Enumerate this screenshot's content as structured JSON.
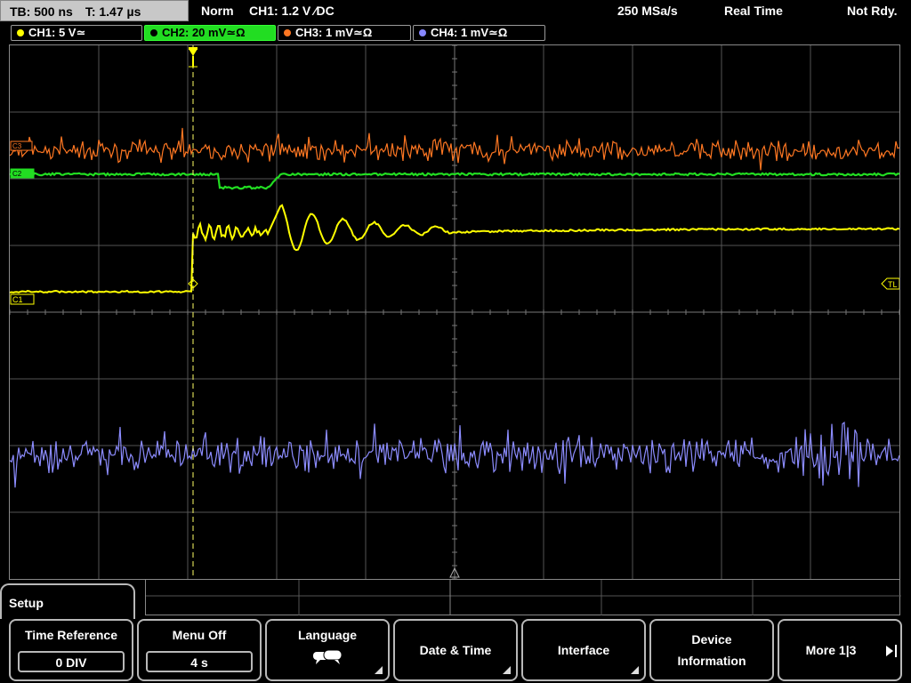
{
  "topbar": {
    "timebase": "TB: 500 ns",
    "trigger_time": "T: 1.47 µs",
    "mode": "Norm",
    "trigger": "CH1: 1.2 V ∕DC",
    "sample_rate": "250 MSa/s",
    "acq_mode": "Real Time",
    "status": "Not Rdy."
  },
  "channels": [
    {
      "label": "CH1: 5 V≃",
      "color": "#ffff00",
      "active": false
    },
    {
      "label": "CH2: 20 mV≃Ω",
      "color": "#22dd22",
      "active": true
    },
    {
      "label": "CH3: 1 mV≃Ω",
      "color": "#ff7722",
      "active": false
    },
    {
      "label": "CH4: 1 mV≃Ω",
      "color": "#8888ff",
      "active": false
    }
  ],
  "markers": {
    "trigger_level": "TL",
    "ch1": "C1",
    "ch2": "C2",
    "ch3": "C3"
  },
  "menu": {
    "title": "Setup",
    "softkeys": {
      "time_reference": {
        "label": "Time Reference",
        "value": "0 DIV"
      },
      "menu_off": {
        "label": "Menu Off",
        "value": "4 s"
      },
      "language": {
        "label": "Language"
      },
      "date_time": {
        "label": "Date & Time"
      },
      "interface": {
        "label": "Interface"
      },
      "device_info": {
        "line1": "Device",
        "line2": "Information"
      },
      "more": {
        "label": "More 1|3"
      }
    }
  },
  "colors": {
    "ch1": "#ffff00",
    "ch2": "#22dd22",
    "ch3": "#ff7722",
    "ch4": "#8c8cff",
    "grid": "#555555"
  }
}
